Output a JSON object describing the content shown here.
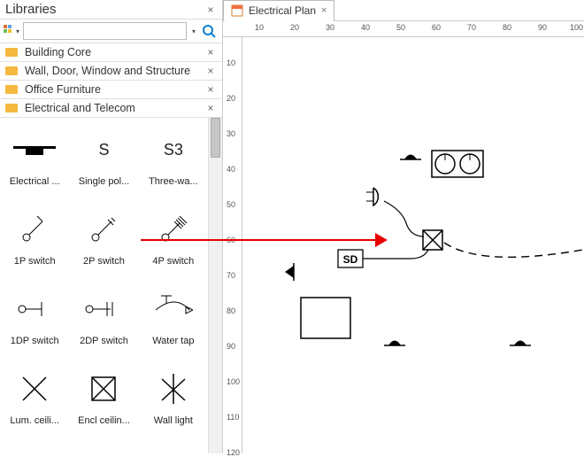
{
  "sidebar": {
    "title": "Libraries",
    "search_placeholder": "",
    "categories": [
      {
        "label": "Building Core"
      },
      {
        "label": "Wall, Door, Window and Structure"
      },
      {
        "label": "Office Furniture"
      },
      {
        "label": "Electrical and Telecom"
      }
    ],
    "shapes": [
      {
        "label": "Electrical ..."
      },
      {
        "label": "Single pol..."
      },
      {
        "label": "Three-wa..."
      },
      {
        "label": "1P switch"
      },
      {
        "label": "2P switch"
      },
      {
        "label": "4P switch"
      },
      {
        "label": "1DP switch"
      },
      {
        "label": "2DP switch"
      },
      {
        "label": "Water tap"
      },
      {
        "label": "Lum. ceili..."
      },
      {
        "label": "Encl ceilin..."
      },
      {
        "label": "Wall light"
      }
    ]
  },
  "tab": {
    "label": "Electrical Plan"
  },
  "ruler_h": [
    "10",
    "20",
    "30",
    "40",
    "50",
    "60",
    "70",
    "80",
    "90",
    "100"
  ],
  "ruler_v": [
    "10",
    "20",
    "30",
    "40",
    "50",
    "60",
    "70",
    "80",
    "90",
    "100",
    "110",
    "120"
  ],
  "canvas": {
    "sd_label": "SD"
  }
}
